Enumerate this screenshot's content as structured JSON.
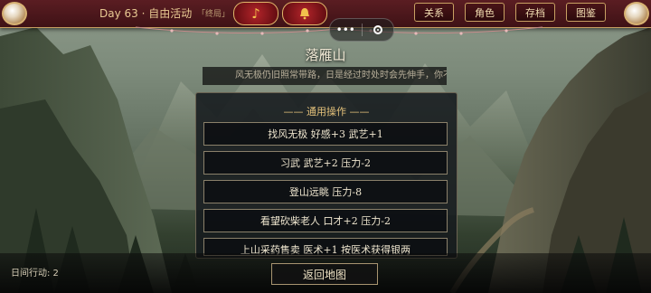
{
  "header": {
    "day": "Day 63 · 自由活动",
    "ending": "「终局」",
    "music_note": "♪",
    "bell_icon": "bell",
    "nav": [
      "关系",
      "角色",
      "存档",
      "图鉴"
    ]
  },
  "capsule": {
    "menu": "•••"
  },
  "location": {
    "name": "落雁山",
    "description": "风无极仍旧照常带路，日是经过时处时会先伸手，你不就，"
  },
  "panel": {
    "title": "—— 通用操作 ——",
    "actions": [
      "找风无极  好感+3 武艺+1",
      "习武  武艺+2 压力-2",
      "登山远眺  压力-8",
      "看望砍柴老人  口才+2 压力-2",
      "上山采药售卖  医术+1 按医术获得银两"
    ]
  },
  "footer": {
    "daily_actions": "日间行动: 2",
    "return_label": "返回地图"
  },
  "colors": {
    "accent_gold": "#c8a062",
    "bar_red": "#5a1d22"
  }
}
